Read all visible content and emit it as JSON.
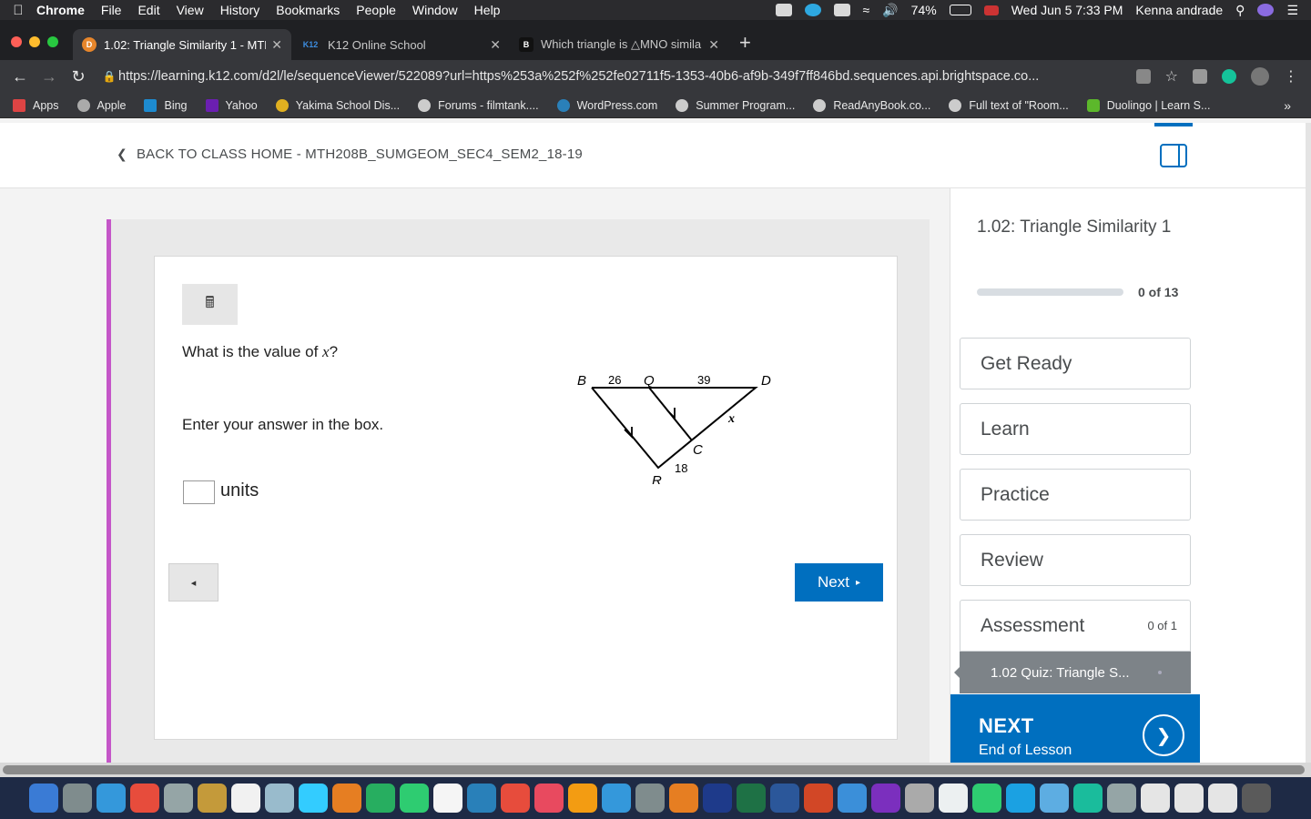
{
  "menubar": {
    "app": "Chrome",
    "items": [
      "File",
      "Edit",
      "View",
      "History",
      "Bookmarks",
      "People",
      "Window",
      "Help"
    ],
    "battery": "74%",
    "datetime": "Wed Jun 5  7:33 PM",
    "user": "Kenna andrade"
  },
  "tabs": [
    {
      "title": "1.02: Triangle Similarity 1 - MTH",
      "active": true,
      "favicon_color": "#e7862b"
    },
    {
      "title": "K12 Online School",
      "active": false,
      "favicon_color": "#1a5aa6",
      "favicon_text": "K12"
    },
    {
      "title": "Which triangle is △MNO simila",
      "active": false,
      "favicon_color": "#111111",
      "favicon_text": "B"
    }
  ],
  "toolbar": {
    "url": "https://learning.k12.com/d2l/le/sequenceViewer/522089?url=https%253a%252f%252fe02711f5-1353-40b6-af9b-349f7ff846bd.sequences.api.brightspace.co..."
  },
  "bookmarks": [
    {
      "label": "Apps",
      "color": "#d44"
    },
    {
      "label": "Apple",
      "color": "#aaa"
    },
    {
      "label": "Bing",
      "color": "#1d8bd0"
    },
    {
      "label": "Yahoo",
      "color": "#6b1fb1"
    },
    {
      "label": "Yakima School Dis...",
      "color": "#e0b020"
    },
    {
      "label": "Forums - filmtank....",
      "color": "#ccc"
    },
    {
      "label": "WordPress.com",
      "color": "#2a80b9"
    },
    {
      "label": "Summer Program...",
      "color": "#ccc"
    },
    {
      "label": "ReadAnyBook.co...",
      "color": "#ccc"
    },
    {
      "label": "Full text of \"Room...",
      "color": "#ccc"
    },
    {
      "label": "Duolingo | Learn S...",
      "color": "#5cb82b"
    }
  ],
  "header": {
    "back_label": "BACK TO CLASS HOME - MTH208B_SUMGEOM_SEC4_SEM2_18-19"
  },
  "question": {
    "prompt_prefix": "What is the value of ",
    "prompt_var": "x",
    "prompt_suffix": "?",
    "instruction": "Enter your answer in the box.",
    "answer_value": "",
    "units": "units",
    "diagram": {
      "labels": {
        "B": "B",
        "Q": "Q",
        "D": "D",
        "C": "C",
        "R": "R"
      },
      "measures": {
        "BQ": "26",
        "QD": "39",
        "CD": "x",
        "RC": "18"
      }
    }
  },
  "nav": {
    "prev_icon": "◂",
    "next_label": "Next",
    "next_icon": "▸"
  },
  "sidebar": {
    "title": "1.02: Triangle Similarity 1",
    "progress_text": "0 of 13",
    "progress_fraction": 0,
    "items": [
      {
        "label": "Get Ready",
        "count": ""
      },
      {
        "label": "Learn",
        "count": ""
      },
      {
        "label": "Practice",
        "count": ""
      },
      {
        "label": "Review",
        "count": ""
      },
      {
        "label": "Assessment",
        "count": "0 of 1"
      }
    ],
    "sub_item": "1.02 Quiz: Triangle S...",
    "next_title": "NEXT",
    "next_subtitle": "End of Lesson"
  },
  "dock_colors": [
    "#3a7bd5",
    "#7f8c8d",
    "#3498db",
    "#e74c3c",
    "#95a5a6",
    "#c49a3a",
    "#f1f1f1",
    "#9bc",
    "#3cf",
    "#e67e22",
    "#27ae60",
    "#2ecc71",
    "#f5f5f5",
    "#2980b9",
    "#e74c3c",
    "#e84a5f",
    "#f39c12",
    "#3498db",
    "#7f8c8d",
    "#e67e22",
    "#1e3a8a",
    "#1e7145",
    "#2b579a",
    "#d24726",
    "#3b8fd9",
    "#7b2fbe",
    "#aaa",
    "#ecf0f1",
    "#2ecc71",
    "#1ba1e2",
    "#5dade2",
    "#1abc9c",
    "#95a5a6",
    "#e5e5e5",
    "#e5e5e5",
    "#e5e5e5",
    "#5a5a5a"
  ]
}
